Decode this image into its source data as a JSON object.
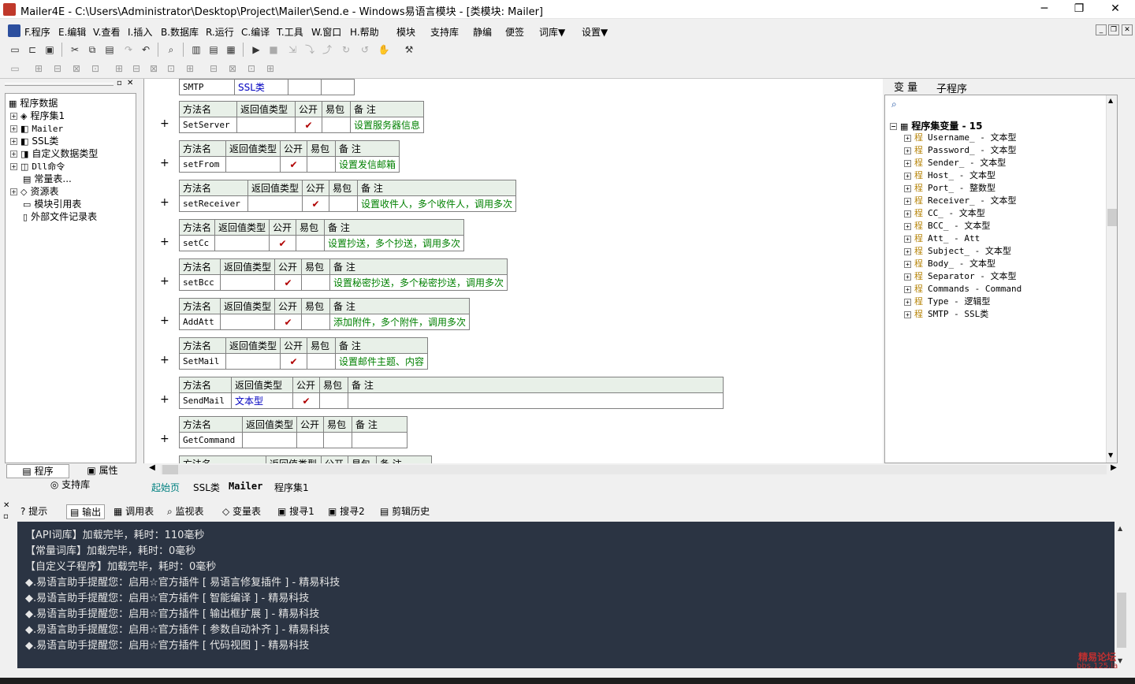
{
  "window": {
    "title": "Mailer4E - C:\\Users\\Administrator\\Desktop\\Project\\Mailer\\Send.e - Windows易语言模块 - [类模块: Mailer]",
    "min_glyph": "─",
    "max_glyph": "❐",
    "close_glyph": "✕"
  },
  "menu": [
    "F.程序",
    "E.编辑",
    "V.查看",
    "I.插入",
    "B.数据库",
    "R.运行",
    "C.编译",
    "T.工具",
    "W.窗口",
    "H.帮助",
    "模块",
    "支持库",
    "静编",
    "便签",
    "词库▼",
    "设置▼"
  ],
  "left_tree": {
    "root": "程序数据",
    "items": [
      "程序集1",
      "Mailer",
      "SSL类",
      "自定义数据类型",
      "Dll命令",
      "常量表...",
      "资源表",
      "模块引用表",
      "外部文件记录表"
    ],
    "tabs": [
      "程序",
      "属性"
    ],
    "support_tab": "支持库"
  },
  "code": {
    "first_row": {
      "name": "SMTP",
      "type": "SSL类"
    },
    "headers": {
      "method": "方法名",
      "ret": "返回值类型",
      "public": "公开",
      "easy": "易包",
      "note": "备 注"
    },
    "check": "✔",
    "methods": [
      {
        "name": "SetServer",
        "ret": "",
        "public": true,
        "note": "设置服务器信息"
      },
      {
        "name": "setFrom",
        "ret": "",
        "public": true,
        "note": "设置发信邮箱"
      },
      {
        "name": "setReceiver",
        "ret": "",
        "public": true,
        "note": "设置收件人，多个收件人，调用多次"
      },
      {
        "name": "setCc",
        "ret": "",
        "public": true,
        "note": "设置抄送，多个抄送，调用多次"
      },
      {
        "name": "setBcc",
        "ret": "",
        "public": true,
        "note": "设置秘密抄送，多个秘密抄送，调用多次"
      },
      {
        "name": "AddAtt",
        "ret": "",
        "public": true,
        "note": "添加附件，多个附件，调用多次"
      },
      {
        "name": "SetMail",
        "ret": "",
        "public": true,
        "note": "设置邮件主题、内容"
      },
      {
        "name": "SendMail",
        "ret": "文本型",
        "public": true,
        "note": ""
      },
      {
        "name": "GetCommand",
        "ret": "",
        "public": false,
        "note": ""
      }
    ],
    "tabs": [
      "起始页",
      "SSL类",
      "Mailer",
      "程序集1"
    ]
  },
  "right_panel": {
    "tabs": [
      "变 量",
      "子程序"
    ],
    "root": "程序集变量 - 15",
    "item_prefix": "程",
    "vars": [
      "Username_ - 文本型",
      "Password_ - 文本型",
      "Sender_ - 文本型",
      "Host_ - 文本型",
      "Port_ - 整数型",
      "Receiver_ - 文本型",
      "CC_ - 文本型",
      "BCC_ - 文本型",
      "Att_ - Att",
      "Subject_ - 文本型",
      "Body_ - 文本型",
      "Separator - 文本型",
      "Commands - Command",
      "Type - 逻辑型",
      "SMTP - SSL类"
    ]
  },
  "bottom": {
    "tabs": [
      "提示",
      "输出",
      "调用表",
      "监视表",
      "变量表",
      "搜寻1",
      "搜寻2",
      "剪辑历史"
    ],
    "lines": [
      "【API词库】加载完毕，耗时：110毫秒",
      "【常量词库】加载完毕，耗时：0毫秒",
      "【自定义子程序】加载完毕，耗时：0毫秒",
      "◆.易语言助手提醒您：启用☆官方插件 [ 易语言修复插件 ] - 精易科技",
      "◆.易语言助手提醒您：启用☆官方插件 [ 智能编译 ] - 精易科技",
      "◆.易语言助手提醒您：启用☆官方插件 [ 输出框扩展 ] - 精易科技",
      "◆.易语言助手提醒您：启用☆官方插件 [ 参数自动补齐 ] - 精易科技",
      "◆.易语言助手提醒您：启用☆官方插件 [ 代码视图 ] - 精易科技"
    ],
    "watermark": "精易论坛",
    "watermark_url": "bbs.125.la"
  }
}
